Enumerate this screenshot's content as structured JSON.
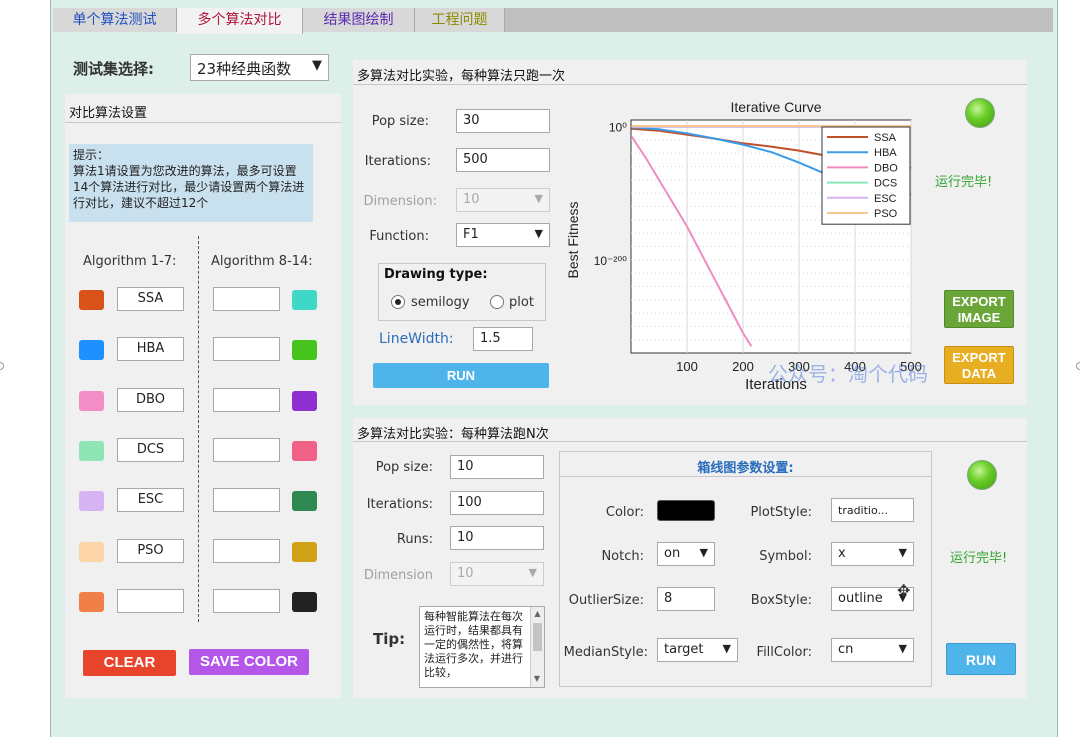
{
  "tabs": [
    {
      "label": "单个算法测试",
      "color": "#1f4fbf"
    },
    {
      "label": "多个算法对比",
      "color": "#b0133a"
    },
    {
      "label": "结果图绘制",
      "color": "#5a2ab0"
    },
    {
      "label": "工程问题",
      "color": "#8b8b00"
    }
  ],
  "testset": {
    "label": "测试集选择:",
    "value": "23种经典函数"
  },
  "left": {
    "title": "对比算法设置",
    "hint": "提示：\n算法1请设置为您改进的算法，最多可设置14个算法进行对比，最少请设置两个算法进行对比，建议不超过12个",
    "col1_header": "Algorithm 1-7:",
    "col2_header": "Algorithm 8-14:",
    "algos_left": [
      {
        "name": "SSA",
        "color": "#d95319"
      },
      {
        "name": "HBA",
        "color": "#1e90ff"
      },
      {
        "name": "DBO",
        "color": "#f28ec5"
      },
      {
        "name": "DCS",
        "color": "#8ee6b4"
      },
      {
        "name": "ESC",
        "color": "#d6b3f2"
      },
      {
        "name": "PSO",
        "color": "#fbd5a6"
      },
      {
        "name": "",
        "color": "#f08048"
      }
    ],
    "algos_right": [
      {
        "name": "",
        "color": "#3fd8c6"
      },
      {
        "name": "",
        "color": "#47c31d"
      },
      {
        "name": "",
        "color": "#8f2fd1"
      },
      {
        "name": "",
        "color": "#f06285"
      },
      {
        "name": "",
        "color": "#2e8a52"
      },
      {
        "name": "",
        "color": "#d1a218"
      },
      {
        "name": "",
        "color": "#222222"
      }
    ],
    "clear_label": "CLEAR",
    "save_color_label": "SAVE COLOR"
  },
  "single": {
    "title": "多算法对比实验，每种算法只跑一次",
    "pop_label": "Pop size:",
    "pop_value": "30",
    "iter_label": "Iterations:",
    "iter_value": "500",
    "dim_label": "Dimension:",
    "dim_value": "10",
    "func_label": "Function:",
    "func_value": "F1",
    "drawing_label": "Drawing type:",
    "semilogy_label": "semilogy",
    "plot_label": "plot",
    "linewidth_label": "LineWidth:",
    "linewidth_value": "1.5",
    "run_label": "RUN",
    "status": "运行完毕!",
    "export_image_label": "EXPORT IMAGE",
    "export_data_label": "EXPORT DATA",
    "watermark": "公众号：淘个代码"
  },
  "chart_data": {
    "type": "line",
    "title": "Iterative Curve",
    "xlabel": "Iterations",
    "ylabel": "Best Fitness",
    "yscale": "log",
    "xlim": [
      0,
      500
    ],
    "xticks": [
      100,
      200,
      300,
      400,
      500
    ],
    "ytick_labels": [
      "10⁰",
      "10⁻²⁰⁰"
    ],
    "grid": true,
    "legend_position": "top-right",
    "series": [
      {
        "name": "SSA",
        "color": "#c0502a",
        "x": [
          1,
          50,
          100,
          150,
          200,
          250,
          300,
          350,
          400,
          450,
          500
        ],
        "y": [
          -3,
          -6,
          -12,
          -18,
          -25,
          -30,
          -36,
          -44,
          -48,
          -55,
          -62
        ]
      },
      {
        "name": "HBA",
        "color": "#3a9be8",
        "x": [
          1,
          50,
          100,
          150,
          200,
          250,
          300,
          350,
          400,
          450,
          500
        ],
        "y": [
          -1,
          -4,
          -10,
          -18,
          -27,
          -38,
          -54,
          -72,
          -86,
          -94,
          -102
        ]
      },
      {
        "name": "DBO",
        "color": "#f08cc0",
        "x": [
          1,
          25,
          50,
          75,
          100,
          125,
          150,
          175,
          200,
          215
        ],
        "y": [
          -15,
          -45,
          -80,
          -115,
          -150,
          -190,
          -230,
          -270,
          -310,
          -330
        ]
      },
      {
        "name": "DCS",
        "color": "#8ee6b4",
        "x": [
          1,
          500
        ],
        "y": [
          0,
          0
        ]
      },
      {
        "name": "ESC",
        "color": "#d6b3f2",
        "x": [
          1,
          500
        ],
        "y": [
          0,
          0
        ]
      },
      {
        "name": "PSO",
        "color": "#f7c890",
        "x": [
          1,
          500
        ],
        "y": [
          1,
          1
        ]
      }
    ]
  },
  "multi": {
    "title": "多算法对比实验：每种算法跑N次",
    "pop_label": "Pop size:",
    "pop_value": "10",
    "iter_label": "Iterations:",
    "iter_value": "100",
    "runs_label": "Runs:",
    "runs_value": "10",
    "dim_label": "Dimension",
    "dim_value": "10",
    "tip_label": "Tip:",
    "tip_text": "每种智能算法在每次运行时，结果都具有一定的偶然性，将算法运行多次，并进行比较，",
    "box_title": "箱线图参数设置:",
    "color_label": "Color:",
    "color_value": "#000000",
    "plotstyle_label": "PlotStyle:",
    "plotstyle_value": "traditio...",
    "notch_label": "Notch:",
    "notch_value": "on",
    "symbol_label": "Symbol:",
    "symbol_value": "x",
    "outlier_label": "OutlierSize:",
    "outlier_value": "8",
    "boxstyle_label": "BoxStyle:",
    "boxstyle_value": "outline",
    "median_label": "MedianStyle:",
    "median_value": "target",
    "fill_label": "FillColor:",
    "fill_value": "cn",
    "run_label": "RUN",
    "status": "运行完毕!"
  }
}
